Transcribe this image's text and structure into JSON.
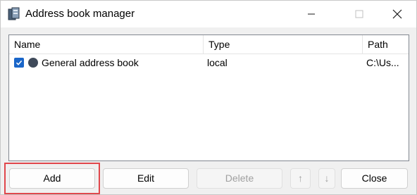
{
  "window": {
    "title": "Address book manager",
    "app_icon": "address-book-icon"
  },
  "list": {
    "columns": [
      "Name",
      "Type",
      "Path"
    ],
    "rows": [
      {
        "checked": true,
        "name": "General address book",
        "type": "local",
        "path": "C:\\Us..."
      }
    ]
  },
  "buttons": {
    "add": "Add",
    "edit": "Edit",
    "delete": "Delete",
    "up": "↑",
    "down": "↓",
    "close": "Close"
  },
  "colors": {
    "checkbox": "#1a66c9",
    "status_dot": "#3f4a5a",
    "highlight": "#e0474c"
  }
}
